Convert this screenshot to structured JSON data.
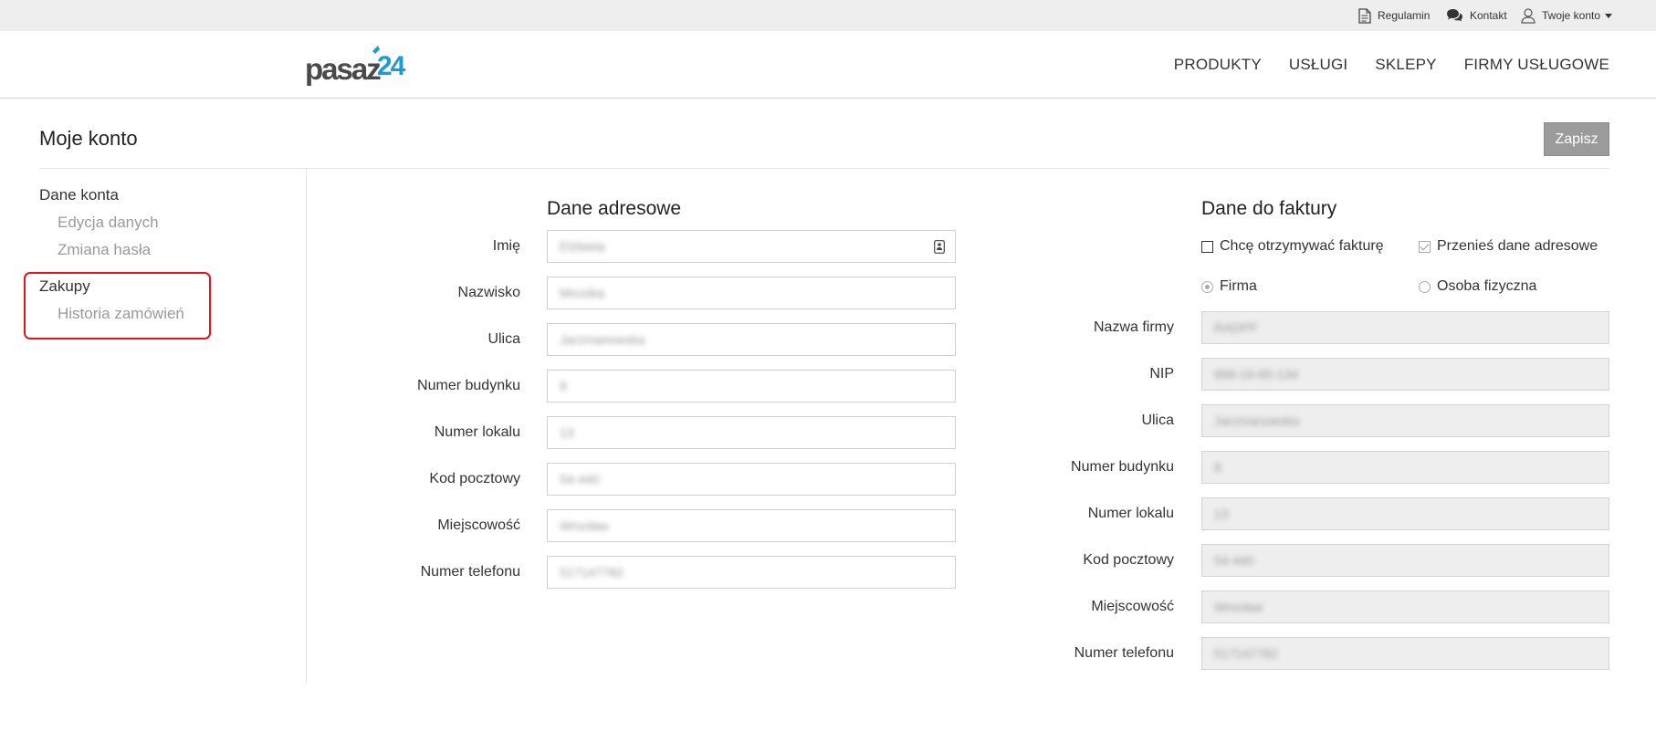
{
  "topbar": {
    "regulamin": "Regulamin",
    "kontakt": "Kontakt",
    "account": "Twoje konto"
  },
  "nav": [
    "PRODUKTY",
    "USŁUGI",
    "SKLEPY",
    "FIRMY USŁUGOWE"
  ],
  "page": {
    "title": "Moje konto",
    "save_label": "Zapisz"
  },
  "sidebar": {
    "section1": "Dane konta",
    "sub1": "Edycja danych",
    "sub2": "Zmiana hasła",
    "section2": "Zakupy",
    "sub3": "Historia zamówień"
  },
  "address": {
    "heading": "Dane adresowe",
    "fields": [
      {
        "label": "Imię",
        "value": "Elżbieta"
      },
      {
        "label": "Nazwisko",
        "value": "Mrozika"
      },
      {
        "label": "Ulica",
        "value": "Jarzmanowska"
      },
      {
        "label": "Numer budynku",
        "value": "8"
      },
      {
        "label": "Numer lokalu",
        "value": "13"
      },
      {
        "label": "Kod pocztowy",
        "value": "54-440"
      },
      {
        "label": "Miejscowość",
        "value": "Wrocław"
      },
      {
        "label": "Numer telefonu",
        "value": "517147782"
      }
    ]
  },
  "invoice": {
    "heading": "Dane do faktury",
    "want_invoice": "Chcę otrzymywać fakturę",
    "copy_address": "Przenieś dane adresowe",
    "firm": "Firma",
    "person": "Osoba fizyczna",
    "fields": [
      {
        "label": "Nazwa firmy",
        "value": "RADPF"
      },
      {
        "label": "NIP",
        "value": "898-19-65-134"
      },
      {
        "label": "Ulica",
        "value": "Jarzmanowska"
      },
      {
        "label": "Numer budynku",
        "value": "8"
      },
      {
        "label": "Numer lokalu",
        "value": "13"
      },
      {
        "label": "Kod pocztowy",
        "value": "54-440"
      },
      {
        "label": "Miejscowość",
        "value": "Wrocław"
      },
      {
        "label": "Numer telefonu",
        "value": "517147782"
      }
    ]
  },
  "colors": {
    "highlight": "#e3141c",
    "logo_gray": "#4a4a4a",
    "logo_blue": "#1e9ad6",
    "save_button": "#9b9b9b"
  }
}
